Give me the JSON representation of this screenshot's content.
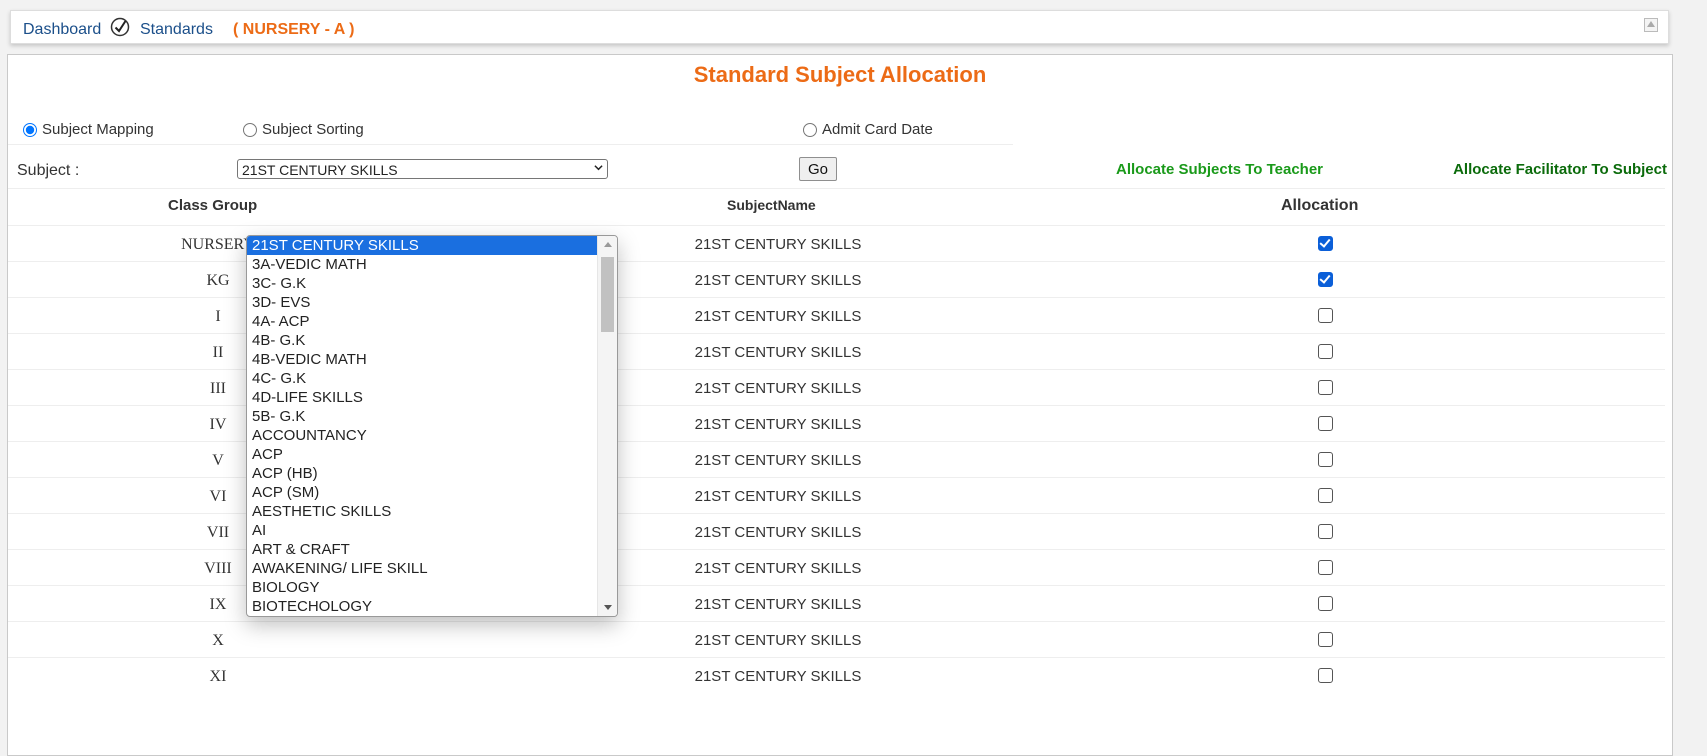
{
  "breadcrumb": {
    "dashboard": "Dashboard",
    "standards": "Standards",
    "current": "( NURSERY - A )"
  },
  "page": {
    "title": "Standard Subject Allocation"
  },
  "modes": {
    "subject_mapping": "Subject Mapping",
    "subject_sorting": "Subject Sorting",
    "admit_card_date": "Admit Card Date",
    "selected": "subject_mapping"
  },
  "subject": {
    "label": "Subject :",
    "selected": "21ST CENTURY SKILLS",
    "go_label": "Go"
  },
  "links": {
    "allocate_teacher": "Allocate Subjects To Teacher",
    "allocate_facilitator": "Allocate Facilitator To Subject"
  },
  "table": {
    "headers": [
      "Class Group",
      "SubjectName",
      "Allocation"
    ],
    "rows": [
      {
        "class": "NURSERY",
        "subject": "21ST CENTURY SKILLS",
        "allocated": true
      },
      {
        "class": "KG",
        "subject": "21ST CENTURY SKILLS",
        "allocated": true
      },
      {
        "class": "I",
        "subject": "21ST CENTURY SKILLS",
        "allocated": false
      },
      {
        "class": "II",
        "subject": "21ST CENTURY SKILLS",
        "allocated": false
      },
      {
        "class": "III",
        "subject": "21ST CENTURY SKILLS",
        "allocated": false
      },
      {
        "class": "IV",
        "subject": "21ST CENTURY SKILLS",
        "allocated": false
      },
      {
        "class": "V",
        "subject": "21ST CENTURY SKILLS",
        "allocated": false
      },
      {
        "class": "VI",
        "subject": "21ST CENTURY SKILLS",
        "allocated": false
      },
      {
        "class": "VII",
        "subject": "21ST CENTURY SKILLS",
        "allocated": false
      },
      {
        "class": "VIII",
        "subject": "21ST CENTURY SKILLS",
        "allocated": false
      },
      {
        "class": "IX",
        "subject": "21ST CENTURY SKILLS",
        "allocated": false
      },
      {
        "class": "X",
        "subject": "21ST CENTURY SKILLS",
        "allocated": false
      },
      {
        "class": "XI",
        "subject": "21ST CENTURY SKILLS",
        "allocated": false
      }
    ]
  },
  "dropdown_options": [
    "21ST CENTURY SKILLS",
    "3A-VEDIC MATH",
    "3C- G.K",
    "3D- EVS",
    "4A- ACP",
    "4B- G.K",
    "4B-VEDIC MATH",
    "4C- G.K",
    "4D-LIFE SKILLS",
    "5B- G.K",
    "ACCOUNTANCY",
    "ACP",
    "ACP (HB)",
    "ACP (SM)",
    "AESTHETIC SKILLS",
    "AI",
    "ART & CRAFT",
    "AWAKENING/ LIFE SKILL",
    "BIOLOGY",
    "BIOTECHOLOGY"
  ],
  "colors": {
    "accent_orange": "#ec6b16",
    "link_blue": "#1b4f8a",
    "link_green": "#1a9a1a",
    "checkbox_blue": "#0b5fd8",
    "select_highlight": "#1a6fe0"
  }
}
